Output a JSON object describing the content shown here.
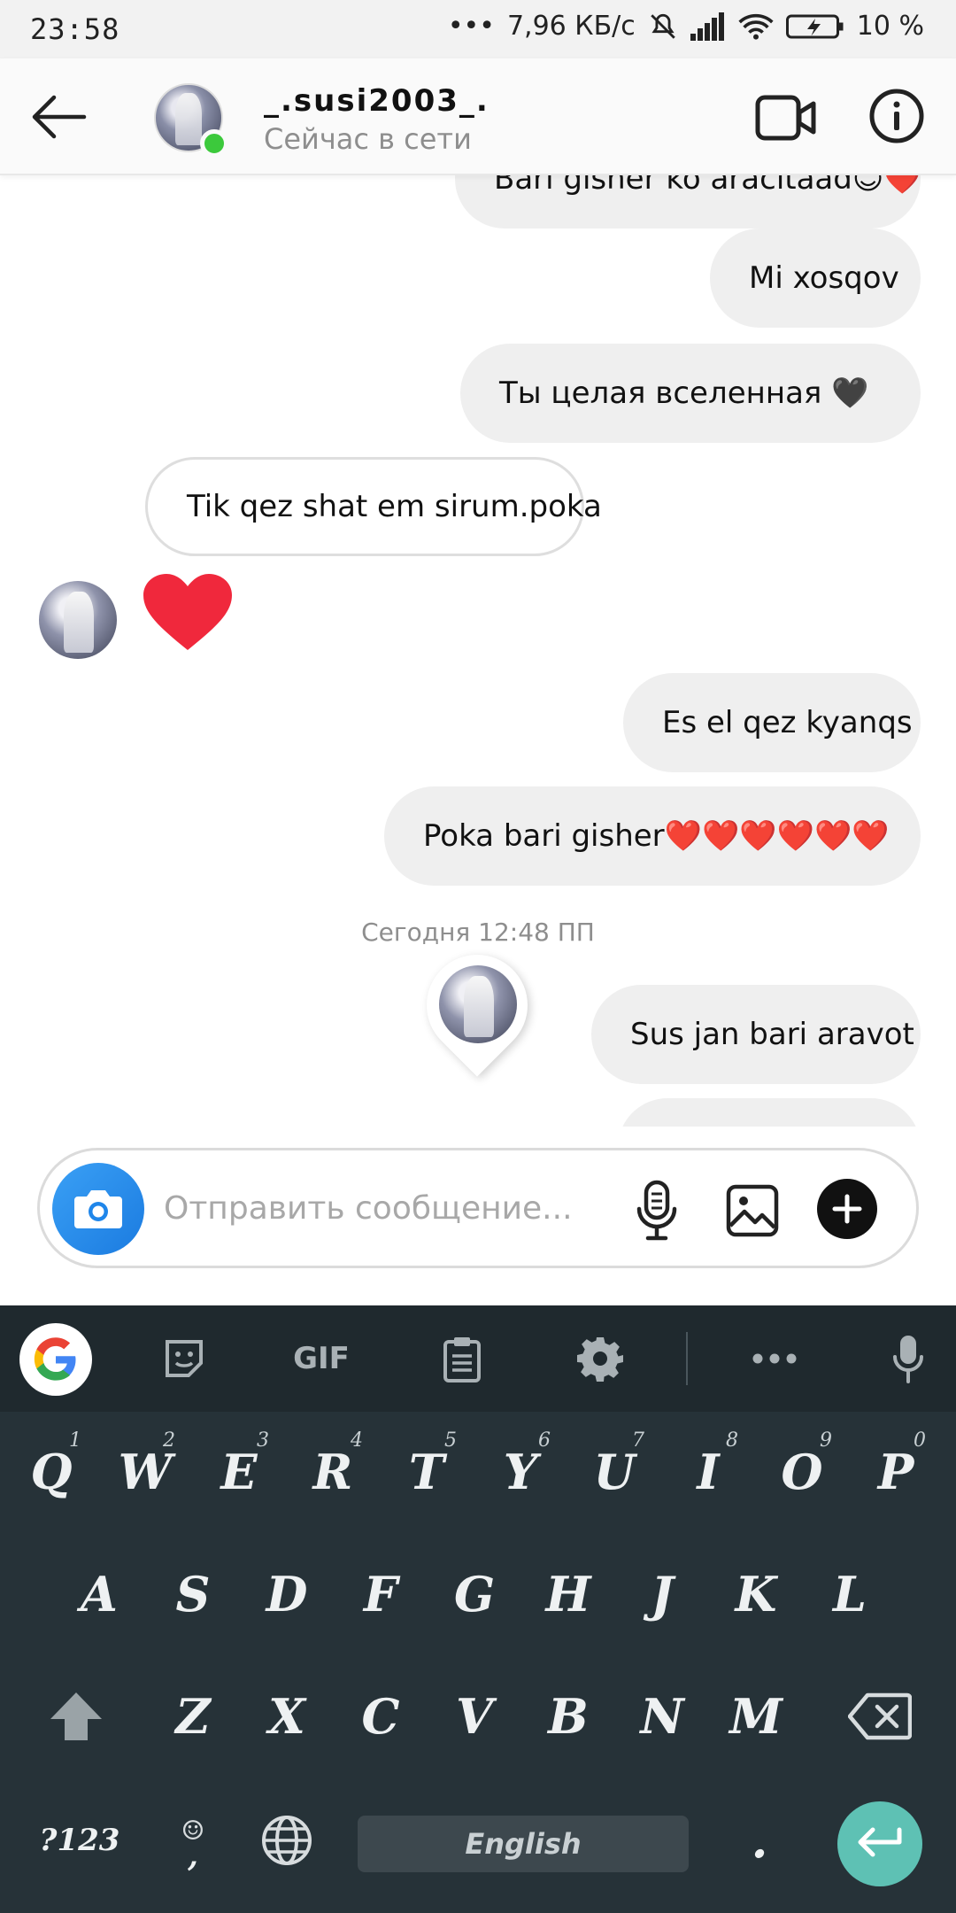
{
  "status_bar": {
    "time": "23:58",
    "network_speed": "7,96 КБ/с",
    "battery": "10 %"
  },
  "header": {
    "username": "_.susi2003_.",
    "status": "Сейчас в сети"
  },
  "messages": [
    {
      "text": "Bari gisher ko aracitaad😊❤️",
      "direction": "out"
    },
    {
      "text": "Mi xosqov",
      "direction": "out"
    },
    {
      "text": "Ты целая вселенная 🖤",
      "direction": "out"
    },
    {
      "text": "Tik qez shat em sirum.poka",
      "direction": "in"
    },
    {
      "text": "❤️",
      "direction": "in"
    },
    {
      "text": "Es el qez kyanqs",
      "direction": "out"
    },
    {
      "text": "Poka bari gisher❤️❤️❤️❤️❤️❤️",
      "direction": "out"
    },
    {
      "text": "Sus jan bari aravot",
      "direction": "out"
    }
  ],
  "day_separator": "Сегодня 12:48 ПП",
  "composer": {
    "placeholder": "Отправить сообщение..."
  },
  "keyboard": {
    "toolbar": {
      "gif_label": "GIF"
    },
    "row1": [
      "Q",
      "W",
      "E",
      "R",
      "T",
      "Y",
      "U",
      "I",
      "O",
      "P"
    ],
    "row1_hints": [
      "1",
      "2",
      "3",
      "4",
      "5",
      "6",
      "7",
      "8",
      "9",
      "0"
    ],
    "row2": [
      "A",
      "S",
      "D",
      "F",
      "G",
      "H",
      "J",
      "K",
      "L"
    ],
    "row3": [
      "Z",
      "X",
      "C",
      "V",
      "B",
      "N",
      "M"
    ],
    "symbols_label": "?123",
    "comma_label": ",",
    "space_label": "English",
    "period_label": "."
  }
}
